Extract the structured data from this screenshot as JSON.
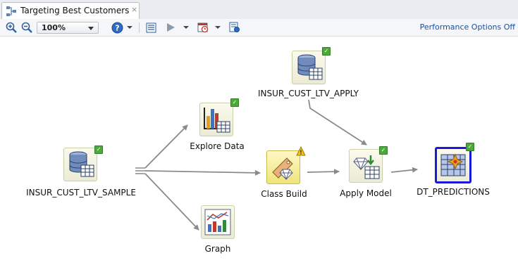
{
  "tab": {
    "title": "Targeting Best Customers",
    "close_glyph": "×"
  },
  "toolbar": {
    "zoom_value": "100%",
    "performance_link": "Performance Options Off",
    "icons": [
      "zoom-in-icon",
      "zoom-out-icon",
      "help-icon",
      "properties-icon",
      "run-icon",
      "schedule-icon",
      "event-log-icon"
    ]
  },
  "workflow": {
    "nodes": [
      {
        "id": "apply_src",
        "label": "INSUR_CUST_LTV_APPLY",
        "type": "data-source",
        "status": "complete"
      },
      {
        "id": "explore",
        "label": "Explore Data",
        "type": "explore",
        "status": "complete"
      },
      {
        "id": "sample",
        "label": "INSUR_CUST_LTV_SAMPLE",
        "type": "data-source",
        "status": "complete"
      },
      {
        "id": "classbuild",
        "label": "Class Build",
        "type": "model-build",
        "status": "warning"
      },
      {
        "id": "applymodel",
        "label": "Apply Model",
        "type": "apply",
        "status": "complete"
      },
      {
        "id": "predictions",
        "label": "DT_PREDICTIONS",
        "type": "table",
        "status": "complete"
      },
      {
        "id": "graph",
        "label": "Graph",
        "type": "graph",
        "status": "none"
      }
    ]
  },
  "colors": {
    "accent": "#1d4e97",
    "check": "#4caa3a",
    "selected_border": "#1a1ad6",
    "link": "#8a8a8a"
  }
}
